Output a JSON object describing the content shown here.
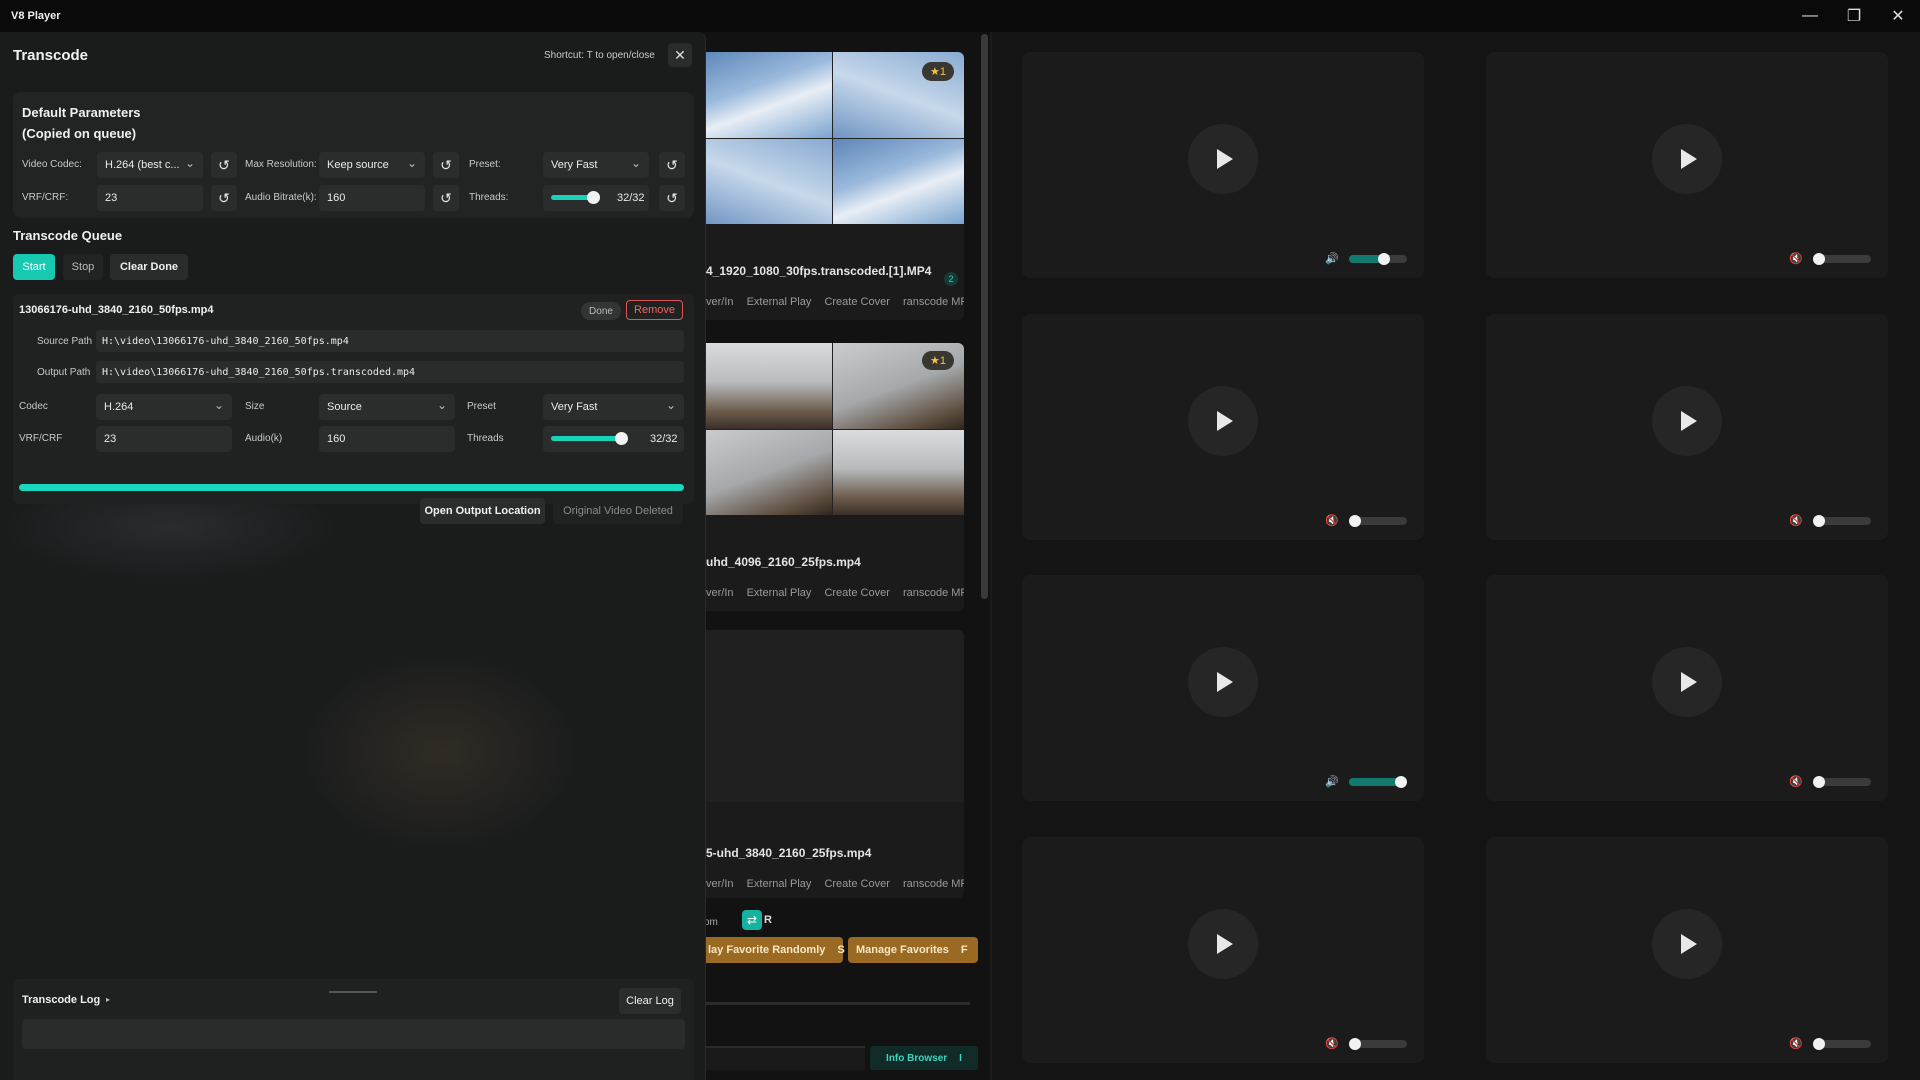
{
  "window": {
    "title": "V8 Player",
    "controls": [
      "—",
      "❐",
      "✕"
    ]
  },
  "transcode": {
    "title": "Transcode",
    "shortcut": "Shortcut: T to open/close",
    "close_glyph": "✕",
    "defaults": {
      "title_line1": "Default Parameters",
      "title_line2": "(Copied on queue)",
      "video_codec_label": "Video Codec:",
      "video_codec_value": "H.264 (best c...",
      "max_res_label": "Max Resolution:",
      "max_res_value": "Keep source",
      "preset_label": "Preset:",
      "preset_value": "Very Fast",
      "vrf_label": "VRF/CRF:",
      "vrf_value": "23",
      "audio_label": "Audio Bitrate(k):",
      "audio_value": "160",
      "threads_label": "Threads:",
      "threads_value": "32/32",
      "threads_fraction": 1.0,
      "reset_glyph": "↺"
    },
    "queue": {
      "title": "Transcode Queue",
      "start_label": "Start",
      "stop_label": "Stop",
      "clear_done_label": "Clear Done",
      "jobs": [
        {
          "name": "13066176-uhd_3840_2160_50fps.mp4",
          "status": "Done",
          "remove_label": "Remove",
          "source_label": "Source Path",
          "source_path": "H:\\video\\13066176-uhd_3840_2160_50fps.mp4",
          "output_label": "Output Path",
          "output_path": "H:\\video\\13066176-uhd_3840_2160_50fps.transcoded.mp4",
          "codec_label": "Codec",
          "codec_value": "H.264",
          "size_label": "Size",
          "size_value": "Source",
          "preset_label": "Preset",
          "preset_value": "Very Fast",
          "vrf_label": "VRF/CRF",
          "vrf_value": "23",
          "audio_label": "Audio(k)",
          "audio_value": "160",
          "threads_label": "Threads",
          "threads_value": "32/32",
          "threads_fraction": 1.0,
          "progress": 1.0,
          "open_output_label": "Open Output Location",
          "deleted_label": "Original Video Deleted"
        }
      ]
    },
    "log": {
      "title": "Transcode Log",
      "arrow": "▸",
      "clear_label": "Clear Log"
    }
  },
  "files": [
    {
      "name": "4_1920_1080_30fps.transcoded.[1].MP4",
      "rating": "★1",
      "count": "2",
      "actions": [
        "ver/In",
        "External Play",
        "Create Cover",
        "ranscode MP4"
      ]
    },
    {
      "name": "uhd_4096_2160_25fps.mp4",
      "rating": "★1",
      "actions": [
        "ver/In",
        "External Play",
        "Create Cover",
        "ranscode MP4"
      ]
    },
    {
      "name": "5-uhd_3840_2160_25fps.mp4",
      "actions": [
        "ver/In",
        "External Play",
        "Create Cover",
        "ranscode MP4"
      ]
    }
  ],
  "mid_controls": {
    "om_label": "om",
    "repeat_glyph": "⇄",
    "repeat_key": "R",
    "play_fav_label": "lay Favorite Randomly",
    "play_fav_key": "S",
    "manage_fav_label": "Manage Favorites",
    "manage_fav_key": "F",
    "info_browser_label": "Info Browser",
    "info_browser_key": "I"
  },
  "players": [
    {
      "muted": false,
      "volume": 0.6
    },
    {
      "muted": true,
      "volume": 0.0
    },
    {
      "muted": true,
      "volume": 0.0
    },
    {
      "muted": true,
      "volume": 0.0
    },
    {
      "muted": false,
      "volume": 0.9
    },
    {
      "muted": true,
      "volume": 0.0
    },
    {
      "muted": true,
      "volume": 0.0
    },
    {
      "muted": true,
      "volume": 0.0
    }
  ],
  "icons": {
    "volume_on": "🔊",
    "volume_muted": "🔇"
  }
}
